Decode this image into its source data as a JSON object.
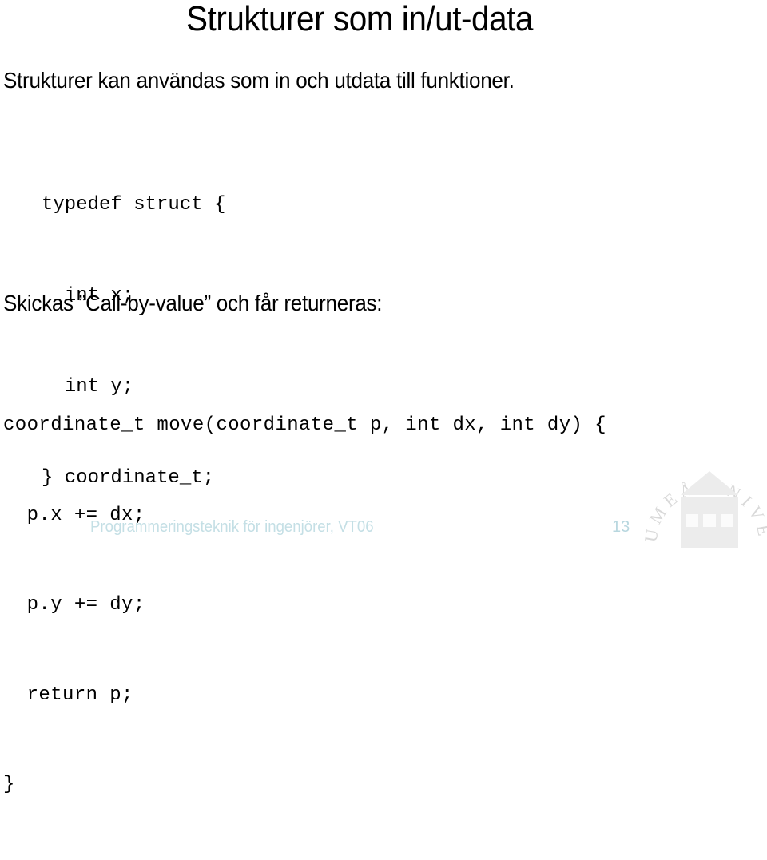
{
  "slide": {
    "title": "Strukturer som in/ut-data",
    "intro": "Strukturer kan användas som in och utdata till funktioner.",
    "struct_code": [
      "typedef struct {",
      "  int x;",
      "  int y;",
      "} coordinate_t;"
    ],
    "call_heading": "Skickas ”Call-by-value” och får returneras:",
    "function_code": [
      "coordinate_t move(coordinate_t p, int dx, int dy) {",
      "  p.x += dx;",
      "  p.y += dy;",
      "  return p;",
      "}"
    ]
  },
  "footer": {
    "course": "Programmeringsteknik för ingenjörer, VT06",
    "page_number": "13",
    "color": "#c4dfe5"
  },
  "logo": {
    "icon": "university-seal-icon",
    "ring_text": "UMEÅ UNIVERSITET",
    "color": "#e3e3e3"
  }
}
